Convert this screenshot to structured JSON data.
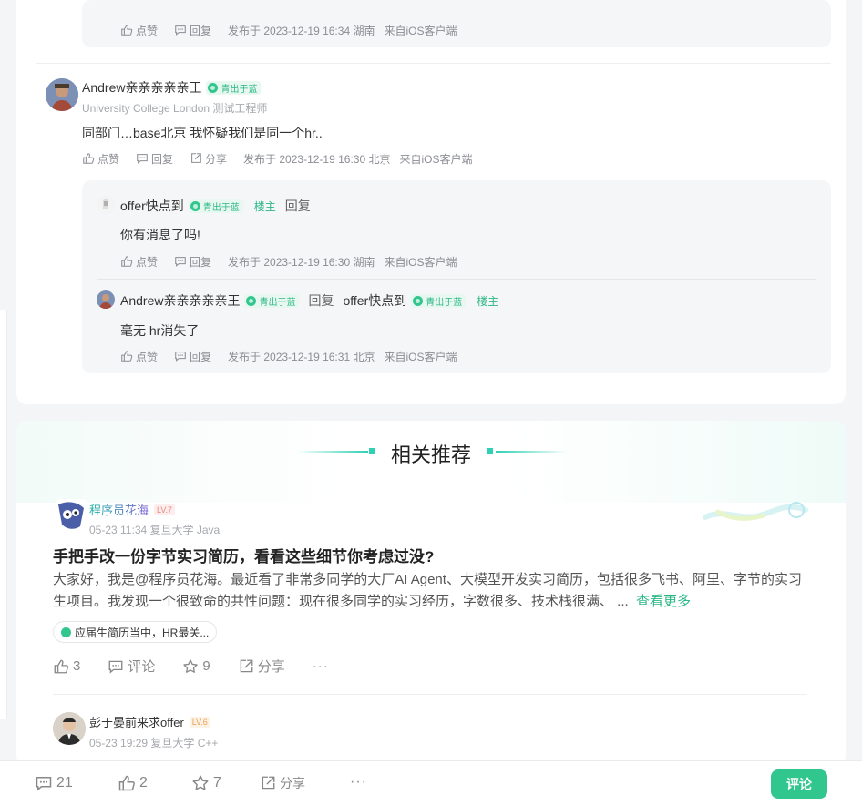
{
  "thread": {
    "top_reply_actions": {
      "like": "点赞",
      "reply": "回复",
      "meta": "发布于 2023-12-19 16:34 湖南",
      "client": "来自iOS客户端"
    },
    "comment": {
      "author": "Andrew亲亲亲亲亲王",
      "badge": "青出于蓝",
      "subtitle": "University College London 测试工程师",
      "text": "同部门…base北京 我怀疑我们是同一个hr..",
      "actions": {
        "like": "点赞",
        "reply": "回复",
        "share": "分享",
        "meta": "发布于 2023-12-19 16:30 北京",
        "client": "来自iOS客户端"
      }
    },
    "replies": [
      {
        "author": "offer快点到",
        "badge": "青出于蓝",
        "owner": "楼主",
        "reply_label": "回复",
        "text": "你有消息了吗!",
        "actions": {
          "like": "点赞",
          "reply": "回复",
          "meta": "发布于 2023-12-19 16:30 湖南",
          "client": "来自iOS客户端"
        }
      },
      {
        "author": "Andrew亲亲亲亲亲王",
        "badge": "青出于蓝",
        "reply_label": "回复",
        "target": "offer快点到",
        "target_badge": "青出于蓝",
        "target_owner": "楼主",
        "text": "毫无 hr消失了",
        "actions": {
          "like": "点赞",
          "reply": "回复",
          "meta": "发布于 2023-12-19 16:31 北京",
          "client": "来自iOS客户端"
        }
      }
    ]
  },
  "recommend": {
    "title": "相关推荐",
    "posts": [
      {
        "author": "程序员花海",
        "level": "LV.7",
        "meta": "05-23 11:34  复旦大学 Java",
        "title": "手把手改一份字节实习简历，看看这些细节你考虑过没?",
        "body": "大家好，我是@程序员花海。最近看了非常多同学的大厂AI Agent、大模型开发实习简历，包括很多飞书、阿里、字节的实习生项目。我发现一个很致命的共性问题：现在很多同学的实习经历，字数很多、技术栈很满、 ...",
        "more": "查看更多",
        "tag": "应届生简历当中，HR最关...",
        "likes": "3",
        "comment_label": "评论",
        "stars": "9",
        "share_label": "分享",
        "dots": "···"
      },
      {
        "author": "彭于晏前来求offer",
        "level": "LV.6",
        "meta": "05-23 19:29  复旦大学 C++"
      }
    ]
  },
  "bottom_bar": {
    "comments": "21",
    "likes": "2",
    "stars": "7",
    "share": "分享",
    "dots": "···",
    "comment_button": "评论"
  },
  "colors": {
    "accent": "#32c68f",
    "accent_text": "#2bb886",
    "lv7": "#f08080",
    "lv6": "#f0a050"
  }
}
